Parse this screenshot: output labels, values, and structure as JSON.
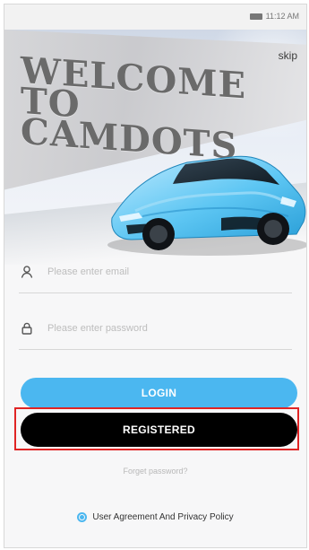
{
  "status_bar": {
    "time": "11:12 AM"
  },
  "hero": {
    "welcome_line1": "WELCOME TO",
    "welcome_line2": "CAMDOTS",
    "skip_label": "skip"
  },
  "form": {
    "username_placeholder": "Please enter email",
    "password_placeholder": "Please enter password"
  },
  "buttons": {
    "login_label": "LOGIN",
    "registered_label": "REGISTERED"
  },
  "links": {
    "forgot_password": "Forget password?"
  },
  "agreement": {
    "text": "User Agreement And Privacy Policy",
    "checked": true
  },
  "colors": {
    "accent": "#4bb7f0",
    "primary_dark": "#000000",
    "highlight": "#e02424"
  },
  "icons": [
    "battery-icon",
    "user-icon",
    "lock-icon",
    "radio-icon"
  ]
}
